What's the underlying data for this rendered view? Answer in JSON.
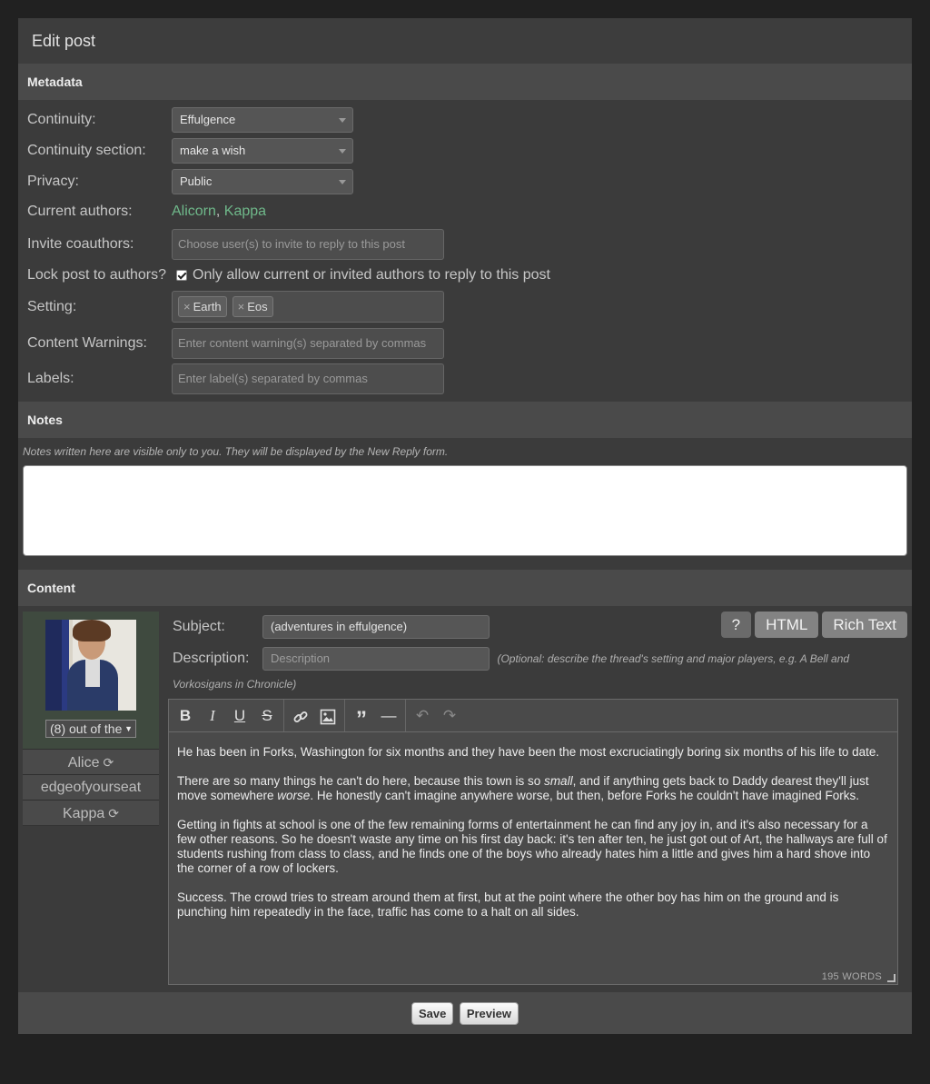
{
  "page": {
    "title": "Edit post"
  },
  "metadata": {
    "heading": "Metadata",
    "continuity": {
      "label": "Continuity:",
      "value": "Effulgence"
    },
    "section": {
      "label": "Continuity section:",
      "value": "make a wish"
    },
    "privacy": {
      "label": "Privacy:",
      "value": "Public"
    },
    "authors": {
      "label": "Current authors:",
      "names": [
        "Alicorn",
        "Kappa"
      ],
      "separator": ", "
    },
    "invite": {
      "label": "Invite coauthors:",
      "placeholder": "Choose user(s) to invite to reply to this post"
    },
    "lock": {
      "label": "Lock post to authors?",
      "text": "Only allow current or invited authors to reply to this post",
      "checked": true
    },
    "setting": {
      "label": "Setting:",
      "tags": [
        "Earth",
        "Eos"
      ],
      "remove_glyph": "×"
    },
    "warnings": {
      "label": "Content Warnings:",
      "placeholder": "Enter content warning(s) separated by commas"
    },
    "labels": {
      "label": "Labels:",
      "placeholder": "Enter label(s) separated by commas"
    }
  },
  "notes": {
    "heading": "Notes",
    "hint": "Notes written here are visible only to you. They will be displayed by the New Reply form."
  },
  "content": {
    "heading": "Content",
    "alias": "(8) out of the",
    "characters": [
      {
        "name": "Alice",
        "swap": true
      },
      {
        "name": "edgeofyourseat",
        "swap": false
      },
      {
        "name": "Kappa",
        "swap": true
      }
    ],
    "subject": {
      "label": "Subject:",
      "value": "(adventures in effulgence)"
    },
    "description": {
      "label": "Description:",
      "placeholder": "Description",
      "hint": "(Optional: describe the thread's setting and major players, e.g. A Bell and Vorkosigans in Chronicle)"
    },
    "modes": {
      "help": "?",
      "html": "HTML",
      "rich": "Rich Text"
    },
    "toolbar_icons": [
      "bold-icon",
      "italic-icon",
      "underline-icon",
      "strikethrough-icon",
      "link-icon",
      "image-icon",
      "blockquote-icon",
      "horizontal-rule-icon",
      "undo-icon",
      "redo-icon"
    ],
    "paragraphs": [
      "He has been in Forks, Washington for six months and they have been the most excruciatingly boring six months of his life to date.",
      {
        "before": "There are so many things he can't do here, because this town is so ",
        "em1": "small",
        "middle": ", and if anything gets back to Daddy dearest they'll just move somewhere ",
        "em2": "worse",
        "after": ". He honestly can't imagine anywhere worse, but then, before Forks he couldn't have imagined Forks."
      },
      "Getting in fights at school is one of the few remaining forms of entertainment he can find any joy in, and it's also necessary for a few other reasons. So he doesn't waste any time on his first day back: it's ten after ten, he just got out of Art, the hallways are full of students rushing from class to class, and he finds one of the boys who already hates him a little and gives him a hard shove into the corner of a row of lockers.",
      "Success. The crowd tries to stream around them at first, but at the point where the other boy has him on the ground and is punching him repeatedly in the face, traffic has come to a halt on all sides."
    ],
    "word_count": "195 WORDS"
  },
  "footer": {
    "save": "Save",
    "preview": "Preview"
  },
  "colors": {
    "author_link": "#6fb88a",
    "panel": "#3b3b3b",
    "section_header": "#4a4a4a"
  }
}
